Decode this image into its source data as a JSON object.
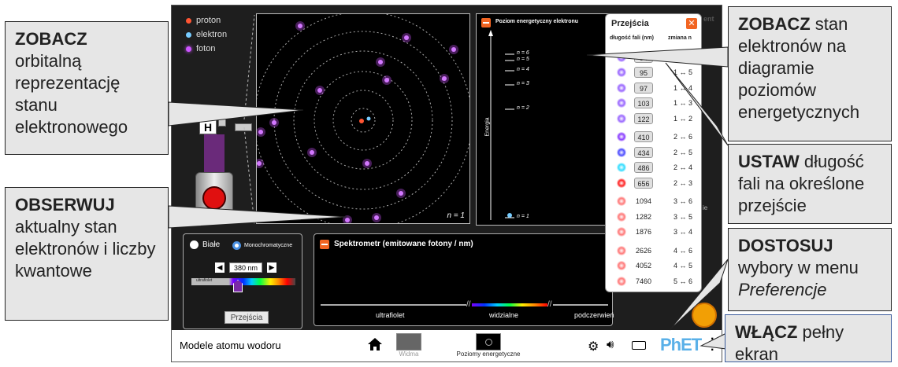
{
  "sim": {
    "title": "Modele atomu wodoru",
    "legend": [
      {
        "label": "proton",
        "color": "#ff5533"
      },
      {
        "label": "elektron",
        "color": "#77ccff"
      },
      {
        "label": "foton",
        "color": "#cc55ff"
      }
    ],
    "gun_label": "H",
    "orbit_label": "n = 1",
    "energy_panel": {
      "title": "Poziom energetyczny elektronu",
      "axis_label": "Energia",
      "levels": [
        "n = 6",
        "n = 5",
        "n = 4",
        "n = 3",
        "n = 2",
        "n = 1"
      ]
    },
    "transitions": {
      "title": "Przejścia",
      "col_wavelength": "długość fali (nm)",
      "col_change": "zmiana n",
      "rows": [
        {
          "wl": "94",
          "change": "1 ↔ 6",
          "color": "#9966ff",
          "btn": true
        },
        {
          "wl": "95",
          "change": "1 ↔ 5",
          "color": "#9966ff",
          "btn": true
        },
        {
          "wl": "97",
          "change": "1 ↔ 4",
          "color": "#9966ff",
          "btn": true
        },
        {
          "wl": "103",
          "change": "1 ↔ 3",
          "color": "#9966ff",
          "btn": true
        },
        {
          "wl": "122",
          "change": "1 ↔ 2",
          "color": "#9966ff",
          "btn": true
        },
        {
          "wl": "410",
          "change": "2 ↔ 6",
          "color": "#8a3dff",
          "btn": true
        },
        {
          "wl": "434",
          "change": "2 ↔ 5",
          "color": "#4c4cff",
          "btn": true
        },
        {
          "wl": "486",
          "change": "2 ↔ 4",
          "color": "#33ddff",
          "btn": true
        },
        {
          "wl": "656",
          "change": "2 ↔ 3",
          "color": "#ff2222",
          "btn": true
        },
        {
          "wl": "1094",
          "change": "3 ↔ 6",
          "color": "#ff7777",
          "btn": false
        },
        {
          "wl": "1282",
          "change": "3 ↔ 5",
          "color": "#ff7777",
          "btn": false
        },
        {
          "wl": "1876",
          "change": "3 ↔ 4",
          "color": "#ff7777",
          "btn": false
        },
        {
          "wl": "2626",
          "change": "4 ↔ 6",
          "color": "#ff7777",
          "btn": false
        },
        {
          "wl": "4052",
          "change": "4 ↔ 5",
          "color": "#ff7777",
          "btn": false
        },
        {
          "wl": "7460",
          "change": "5 ↔ 6",
          "color": "#ff7777",
          "btn": false
        }
      ]
    },
    "light": {
      "white": "Białe",
      "mono": "Monochromatyczne",
      "wavelength": "380 nm",
      "uv_label": "ultrafiolet",
      "transitions_button": "Przejścia"
    },
    "spectrometer": {
      "title": "Spektrometr (emitowane fotony / nm)",
      "uv": "ultrafiolet",
      "visible": "widzialne",
      "ir": "podczerwień"
    },
    "nav": {
      "tab1": "Widma",
      "tab2": "Poziomy energetyczne",
      "phet": "PhET"
    }
  },
  "callouts": {
    "c1": {
      "bold": "ZOBACZ",
      "text": " orbitalną reprezentację stanu elektronowego"
    },
    "c2": {
      "bold": "OBSERWUJ",
      "text": " aktualny stan elektronów i liczby kwantowe"
    },
    "c3": {
      "bold": "ZOBACZ",
      "text": " stan elektronów na diagramie poziomów energetycznych"
    },
    "c4": {
      "bold": "USTAW",
      "text": " długość fali na określone przejście"
    },
    "c5": {
      "bold": "DOSTOSUJ",
      "text": " wybory w menu ",
      "italic": "Preferencje"
    },
    "c6": {
      "bold": "WŁĄCZ",
      "text": " pełny ekran"
    }
  }
}
